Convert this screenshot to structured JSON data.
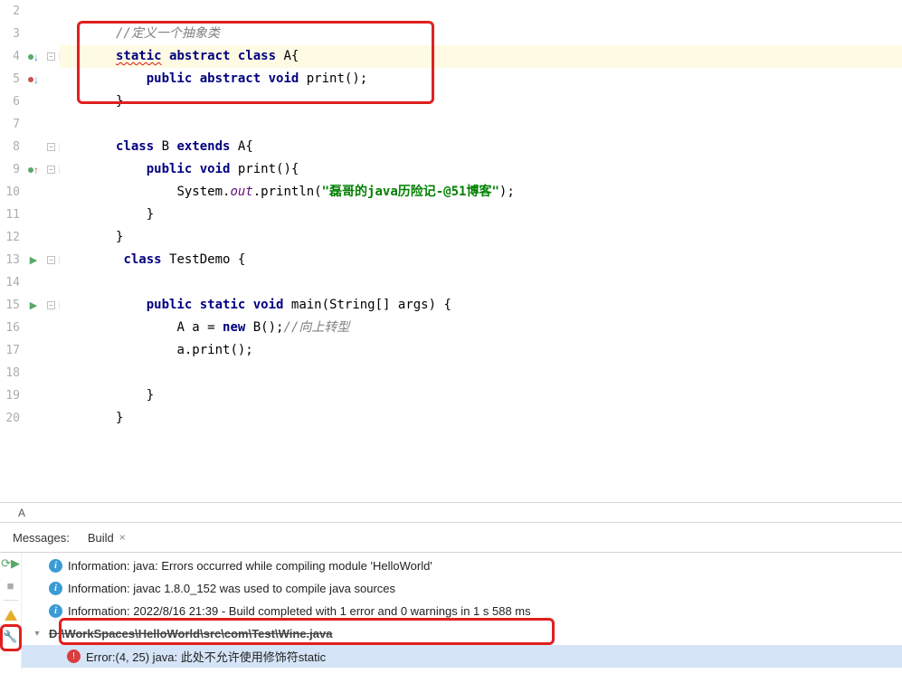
{
  "code": {
    "lines": [
      {
        "n": 2,
        "content": "",
        "gi": ""
      },
      {
        "n": 3,
        "content": "comment1",
        "gi": ""
      },
      {
        "n": 4,
        "content": "static_abstract",
        "gi": "blue-down",
        "highlight": true
      },
      {
        "n": 5,
        "content": "public_abstract_void",
        "gi": "red-down"
      },
      {
        "n": 6,
        "content": "brace_close_1",
        "gi": ""
      },
      {
        "n": 7,
        "content": "",
        "gi": ""
      },
      {
        "n": 8,
        "content": "class_b",
        "gi": ""
      },
      {
        "n": 9,
        "content": "public_void_print",
        "gi": "red-up"
      },
      {
        "n": 10,
        "content": "println",
        "gi": ""
      },
      {
        "n": 11,
        "content": "brace_close_2",
        "gi": ""
      },
      {
        "n": 12,
        "content": "brace_close_1",
        "gi": ""
      },
      {
        "n": 13,
        "content": "class_testdemo",
        "gi": "run"
      },
      {
        "n": 14,
        "content": "",
        "gi": ""
      },
      {
        "n": 15,
        "content": "public_static_main",
        "gi": "run"
      },
      {
        "n": 16,
        "content": "new_b",
        "gi": ""
      },
      {
        "n": 17,
        "content": "a_print",
        "gi": ""
      },
      {
        "n": 18,
        "content": "",
        "gi": ""
      },
      {
        "n": 19,
        "content": "brace_close_2",
        "gi": ""
      },
      {
        "n": 20,
        "content": "brace_close_1",
        "gi": ""
      }
    ],
    "tokens": {
      "comment1": "//定义一个抽象类",
      "static": "static",
      "abstract": "abstract",
      "class": "class",
      "public": "public",
      "void": "void",
      "extends": "extends",
      "new": "new",
      "out": "out",
      "classA": " A{",
      "print_sig": " print();",
      "brace1": "}",
      "brace2": "}",
      "classB_pre": " B ",
      "classB_ext": " A{",
      "print_body": " print(){",
      "println_pre": "System.",
      "println_mid": ".println(",
      "str_lit": "\"磊哥的java历险记-@51博客\"",
      "println_end": ");",
      "testdemo": " TestDemo {",
      "main_sig": " main(String[] args) {",
      "newb_pre": "A a = ",
      "newb_post": " B();",
      "comment2": "//向上转型",
      "aprint": "a.print();"
    }
  },
  "breadcrumb": {
    "item": "A"
  },
  "messages": {
    "label": "Messages:",
    "tabs": [
      {
        "label": "Build",
        "active": true
      }
    ],
    "items": [
      {
        "type": "info",
        "text": "Information: java: Errors occurred while compiling module 'HelloWorld'"
      },
      {
        "type": "info",
        "text": "Information: javac 1.8.0_152 was used to compile java sources"
      },
      {
        "type": "info",
        "text": "Information: 2022/8/16 21:39 - Build completed with 1 error and 0 warnings in 1 s 588 ms"
      },
      {
        "type": "path",
        "text": "D:\\WorkSpaces\\HelloWorld\\src\\com\\Test\\Wine.java"
      },
      {
        "type": "error",
        "text": "Error:(4, 25)  java: 此处不允许使用修饰符static",
        "selected": true
      }
    ]
  }
}
